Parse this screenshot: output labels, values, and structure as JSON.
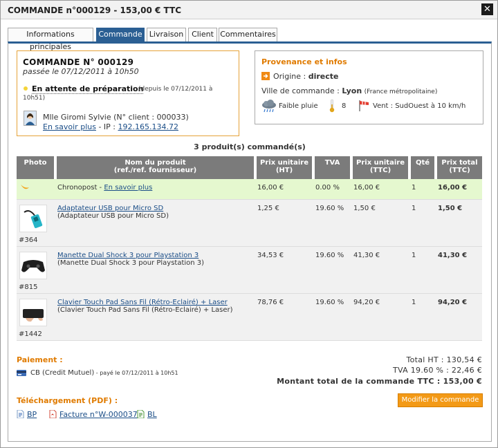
{
  "window": {
    "title": "COMMANDE n°000129 - 153,00 €  TTC"
  },
  "tabs": [
    {
      "label": "Informations principales"
    },
    {
      "label": "Commande"
    },
    {
      "label": "Livraison"
    },
    {
      "label": "Client"
    },
    {
      "label": "Commentaires"
    }
  ],
  "order": {
    "heading": "COMMANDE N° 000129",
    "placed": "passée le 07/12/2011 à 10h50",
    "status": "En attente de préparation",
    "status_since_1": "(depuis le 07/12/2011 à",
    "status_since_2": "10h51)",
    "customer": "Mlle Giromi Sylvie (N° client : 000033)",
    "more_link": "En savoir plus",
    "ip_label": " - IP : ",
    "ip": "192.165.134.72"
  },
  "origin": {
    "title": "Provenance et infos",
    "origin_label": "Origine :",
    "origin_value": "directe",
    "city_label": "Ville de commande :",
    "city": "Lyon",
    "region": "(France métropolitaine)",
    "weather": "Faible pluie",
    "temperature": "8",
    "wind": "Vent : SudOuest à 10 km/h"
  },
  "products": {
    "count_label": "3 produit(s) commandé(s)",
    "headers": {
      "photo": "Photo",
      "name_1": "Nom du produit",
      "name_2": "(ref./ref. fournisseur)",
      "pu_ht_1": "Prix unitaire",
      "pu_ht_2": "(HT)",
      "tva": "TVA",
      "pu_ttc_1": "Prix unitaire",
      "pu_ttc_2": "(TTC)",
      "qty": "Qté",
      "total_1": "Prix total",
      "total_2": "(TTC)"
    },
    "shipping": {
      "name": "Chronopost - ",
      "link": "En savoir plus",
      "pu_ht": "16,00 €",
      "tva": "0.00 %",
      "pu_ttc": "16,00 €",
      "qty": "1",
      "total": "16,00 €"
    },
    "items": [
      {
        "ref": "#364",
        "name": "Adaptateur USB pour Micro SD",
        "sub": "(Adaptateur USB pour Micro SD)",
        "pu_ht": "1,25 €",
        "tva": "19.60 %",
        "pu_ttc": "1,50 €",
        "qty": "1",
        "total": "1,50 €"
      },
      {
        "ref": "#815",
        "name": "Manette Dual Shock 3 pour Playstation 3",
        "sub": "(Manette Dual Shock 3 pour Playstation 3)",
        "pu_ht": "34,53 €",
        "tva": "19.60 %",
        "pu_ttc": "41,30 €",
        "qty": "1",
        "total": "41,30 €"
      },
      {
        "ref": "#1442",
        "name": "Clavier Touch Pad Sans Fil (Rétro-Eclairé) + Laser",
        "sub": "(Clavier Touch Pad Sans Fil (Rétro-Eclairé) + Laser)",
        "pu_ht": "78,76 €",
        "tva": "19.60 %",
        "pu_ttc": "94,20 €",
        "qty": "1",
        "total": "94,20 €"
      }
    ]
  },
  "payment": {
    "title": "Paiement :",
    "method": "CB (Credit Mutuel)",
    "paid": " - payé le 07/12/2011 à 10h51"
  },
  "totals": {
    "ht": "Total HT : 130,54 €",
    "tva": "TVA 19.60 % : 22,46 €",
    "ttc": "Montant total de la commande TTC : 153,00 €"
  },
  "downloads": {
    "title": "Téléchargement (PDF) :",
    "bp": "BP",
    "invoice": "Facture n°W-000037",
    "bl": "BL"
  },
  "actions": {
    "modify": "Modifier la commande"
  },
  "colors": {
    "accent_blue": "#2b5f93",
    "orange": "#e07b00",
    "shipping_row": "#e5f8cf",
    "button": "#f39a17"
  }
}
